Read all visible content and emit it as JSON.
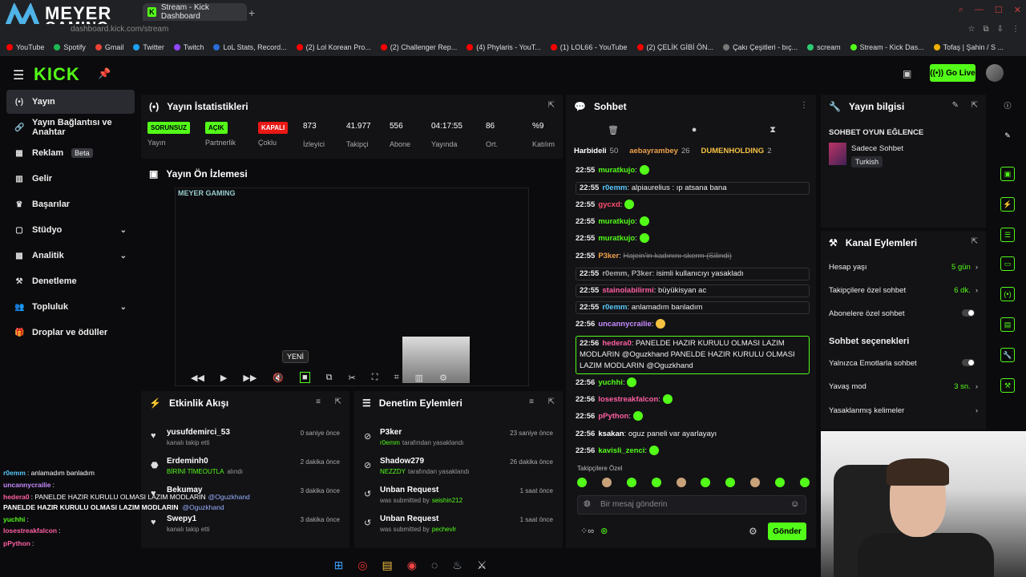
{
  "browser": {
    "brand_line1": "MEYER",
    "brand_line2": "GAMING",
    "tab_title": "Stream - Kick Dashboard",
    "url": "dashboard.kick.com/stream",
    "bookmarks": [
      "YouTube",
      "Spotify",
      "Gmail",
      "Twitter",
      "Twitch",
      "LoL Stats, Record...",
      "(2) Lol Korean Pro...",
      "(2) Challenger Rep...",
      "(4) Phylaris - YouT...",
      "(1) LOL66 - YouTube",
      "(2) ÇELİK GİBİ ÖN...",
      "Çakı Çeşitleri - bıç...",
      "scream",
      "Stream - Kick Das...",
      "Tofaş | Şahin / S ..."
    ]
  },
  "header": {
    "logo": "KICK",
    "go_live": "Go Live"
  },
  "sidebar": {
    "items": [
      {
        "label": "Yayın",
        "icon": "broadcast-icon"
      },
      {
        "label": "Yayın Bağlantısı ve Anahtar",
        "icon": "link-icon"
      },
      {
        "label": "Reklam",
        "icon": "ad-icon",
        "badge": "Beta"
      },
      {
        "label": "Gelir",
        "icon": "revenue-icon"
      },
      {
        "label": "Başarılar",
        "icon": "trophy-icon"
      },
      {
        "label": "Stüdyo",
        "icon": "studio-icon"
      },
      {
        "label": "Analitik",
        "icon": "analytics-icon"
      },
      {
        "label": "Denetleme",
        "icon": "hammer-icon"
      },
      {
        "label": "Topluluk",
        "icon": "community-icon"
      },
      {
        "label": "Droplar ve ödüller",
        "icon": "gift-icon"
      }
    ]
  },
  "stats": {
    "title": "Yayın İstatistikleri",
    "items": [
      {
        "value": "SORUNSUZ",
        "label": "Yayın"
      },
      {
        "value": "AÇIK",
        "label": "Partnerlik"
      },
      {
        "value": "KAPALI",
        "label": "Çoklu"
      },
      {
        "value": "873",
        "label": "İzleyici"
      },
      {
        "value": "41.977",
        "label": "Takipçi"
      },
      {
        "value": "556",
        "label": "Abone"
      },
      {
        "value": "04:17:55",
        "label": "Yayında"
      },
      {
        "value": "86",
        "label": "Ort."
      },
      {
        "value": "%9",
        "label": "Katılım"
      }
    ]
  },
  "preview": {
    "title": "Yayın Ön İzlemesi",
    "new_badge": "YENİ",
    "brand": "MEYER GAMING"
  },
  "activity": {
    "title": "Etkinlik Akışı",
    "rows": [
      {
        "user": "yusufdemirci_53",
        "action": "kanalı takip etti",
        "time": "0 saniye önce"
      },
      {
        "user": "Erdeminh0",
        "action": "BİRİNİ TİMEOUTLA",
        "action2": "alındı",
        "time": "2 dakika önce"
      },
      {
        "user": "Bekumay",
        "action": "",
        "time": "3 dakika önce"
      },
      {
        "user": "Swepy1",
        "action": "kanalı takip etti",
        "time": "3 dakika önce"
      }
    ]
  },
  "moderation": {
    "title": "Denetim Eylemleri",
    "rows": [
      {
        "user": "P3ker",
        "by": "r0emm",
        "action": "tarafından yasaklandı",
        "time": "23 saniye önce"
      },
      {
        "user": "Shadow279",
        "by": "NEZZDY",
        "action": "tarafından yasaklandı",
        "time": "26 dakika önce"
      },
      {
        "user": "Unban Request",
        "by": "seishin212",
        "action": "was submitted by",
        "time": "1 saat önce"
      },
      {
        "user": "Unban Request",
        "by": "pechevlr",
        "action": "was submitted by",
        "time": "1 saat önce"
      }
    ]
  },
  "chat": {
    "title": "Sohbet",
    "pinned": [
      {
        "name": "Harbideli",
        "count": "50"
      },
      {
        "name": "aebayrambey",
        "count": "26"
      },
      {
        "name": "DUMENHOLDING",
        "count": "2"
      }
    ],
    "messages": [
      {
        "ts": "22:55",
        "user": "muratkujo",
        "text": "",
        "color": "#53fc18",
        "emote": true
      },
      {
        "ts": "22:55",
        "user": "r0emm",
        "text": "alpiaurelius : ıp atsana bana",
        "color": "#5ac8fa",
        "box": true
      },
      {
        "ts": "22:55",
        "user": "gycxd",
        "text": "",
        "color": "#ff4d6d",
        "emote": true
      },
      {
        "ts": "22:55",
        "user": "muratkujo",
        "text": "",
        "color": "#53fc18",
        "emote": true
      },
      {
        "ts": "22:55",
        "user": "muratkujo",
        "text": "",
        "color": "#53fc18",
        "emote": true
      },
      {
        "ts": "22:55",
        "user": "P3ker",
        "text": "Hajein'in kadınını skerm (Silindi)",
        "color": "#f0a14a",
        "deleted": true
      },
      {
        "ts": "22:55",
        "user": "r0emm, P3ker",
        "text": "isimli kullanıcıyı yasakladı",
        "color": "#aaaaaa",
        "box": true
      },
      {
        "ts": "22:55",
        "user": "stainolabilirmi",
        "text": "büyükisyan ac",
        "color": "#ff5fa2",
        "box": true
      },
      {
        "ts": "22:55",
        "user": "r0emm",
        "text": "anlamadım banladım",
        "color": "#5ac8fa",
        "box": true
      },
      {
        "ts": "22:56",
        "user": "uncannycrailie",
        "text": "",
        "color": "#c78cff",
        "emote": true
      },
      {
        "ts": "22:56",
        "user": "hedera0",
        "text": "PANELDE HAZIR KURULU OLMASI LAZIM MODLARIN @Oguzkhand PANELDE HAZIR KURULU OLMASI LAZIM MODLARIN @Oguzkhand",
        "color": "#ff5fa2",
        "boxg": true
      },
      {
        "ts": "22:56",
        "user": "yuchhi",
        "text": "",
        "color": "#53fc18",
        "emote": true
      },
      {
        "ts": "22:56",
        "user": "losestreakfalcon",
        "text": "",
        "color": "#ff5fa2",
        "emote": true
      },
      {
        "ts": "22:56",
        "user": "pPython",
        "text": "",
        "color": "#ff5fa2",
        "emote": true
      },
      {
        "ts": "22:56",
        "user": "ksakan",
        "text": "oguz paneli var ayarlayayı",
        "color": "#ffffff"
      },
      {
        "ts": "22:56",
        "user": "kavisli_zenci",
        "text": "",
        "color": "#53fc18",
        "emote": true
      }
    ],
    "emotes_label": "Takipçilere Özel",
    "input_placeholder": "Bir mesaj gönderin",
    "send": "Gönder"
  },
  "stream_info": {
    "title": "Yayın bilgisi",
    "stream_title": "SOHBET OYUN EĞLENCE",
    "category": "Sadece Sohbet",
    "tag": "Turkish"
  },
  "channel_actions": {
    "title": "Kanal Eylemleri",
    "rows": [
      {
        "label": "Hesap yaşı",
        "value": "5 gün"
      },
      {
        "label": "Takipçilere özel sohbet",
        "value": "6 dk."
      },
      {
        "label": "Abonelere özel sohbet",
        "toggle": true
      }
    ],
    "section": "Sohbet seçenekleri",
    "options": [
      {
        "label": "Yalnızca Emotlarla sohbet",
        "toggle": true
      },
      {
        "label": "Yavaş mod",
        "value": "3 sn."
      },
      {
        "label": "Yasaklanmış kelimeler",
        "value": ""
      }
    ]
  },
  "overlay": [
    {
      "user": "r0emm",
      "text": ": anlamadım banladım",
      "color": "#5ac8fa"
    },
    {
      "user": "uncannycrailie",
      "text": ":",
      "color": "#c78cff"
    },
    {
      "user": "hedera0",
      "text": ": PANELDE HAZIR KURULU OLMASI LAZIM MODLARIN",
      "color": "#ff5fa2",
      "mention": "@Oguzkhand"
    },
    {
      "user": "PANELDE HAZIR KURULU OLMASI LAZIM MODLARIN",
      "text": "",
      "color": "#ffffff",
      "mention": "@Oguzkhand"
    },
    {
      "user": "yuchhi",
      "text": ":",
      "color": "#53fc18"
    },
    {
      "user": "losestreakfalcon",
      "text": ":",
      "color": "#ff5fa2"
    },
    {
      "user": "pPython",
      "text": ":",
      "color": "#ff5fa2"
    },
    {
      "user": "ksakan",
      "text": ": oguz paneli var ayarlayayı",
      "color": "#ffffff"
    },
    {
      "user": "kavisli_zenci",
      "text": ":",
      "color": "#53fc18"
    }
  ],
  "colors": {
    "accent": "#53fc18",
    "danger": "#e91916",
    "panel": "#131316",
    "bg": "#0b0b0d"
  }
}
